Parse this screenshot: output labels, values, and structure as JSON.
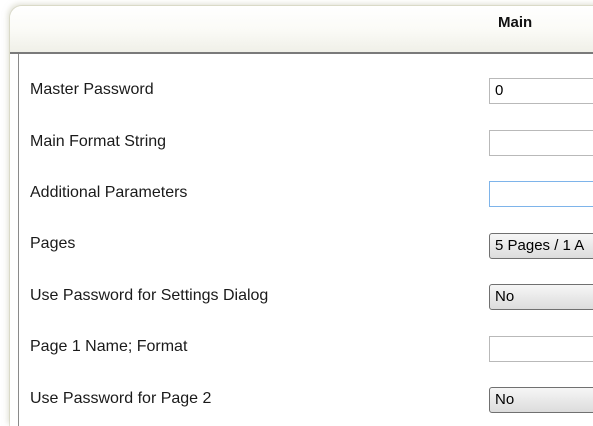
{
  "header": {
    "title": "Main"
  },
  "rows": [
    {
      "label": "Master Password",
      "control": "text",
      "value": "0"
    },
    {
      "label": "Main Format String",
      "control": "text",
      "value": ""
    },
    {
      "label": "Additional Parameters",
      "control": "text",
      "value": ""
    },
    {
      "label": "Pages",
      "control": "combo",
      "value": "5 Pages / 1 A"
    },
    {
      "label": "Use Password for Settings Dialog",
      "control": "combo",
      "value": "No"
    },
    {
      "label": "Page 1 Name; Format",
      "control": "text",
      "value": ""
    },
    {
      "label": "Use Password for Page 2",
      "control": "combo",
      "value": "No"
    }
  ]
}
